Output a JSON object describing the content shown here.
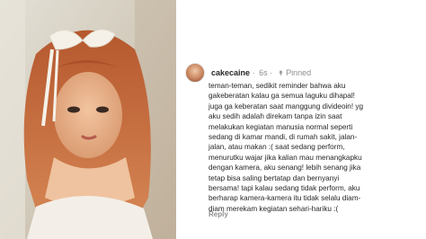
{
  "post": {
    "username": "cakecaine",
    "separator": "·",
    "time": "6s",
    "pinned_label": "Pinned",
    "caption": "teman-teman, sedikit reminder bahwa aku\ngakeberatan kalau ga semua laguku dihapal!\njuga ga keberatan saat manggung divideoin! yg\naku sedih adalah direkam tanpa izin saat\nmelakukan kegiatan manusia normal seperti\nsedang di kamar mandi, di rumah sakit, jalan-\njalan, atau makan :( saat sedang perform,\nmenurutku wajar jika kalian mau menangkapku\ndengan kamera, aku senang! lebih senang jika\ntetap bisa saling bertatap dan bernyanyi\nbersama! tapi kalau sedang tidak perform, aku\nberharap kamera-kamera itu tidak selalu diam-\ndiam merekam kegiatan sehari-hariku :(",
    "reply_label": "Reply"
  },
  "icons": {
    "avatar": "avatar",
    "pin": "pin-icon"
  },
  "colors": {
    "text_primary": "#262626",
    "text_secondary": "#8e8e8e",
    "background": "#ffffff"
  }
}
